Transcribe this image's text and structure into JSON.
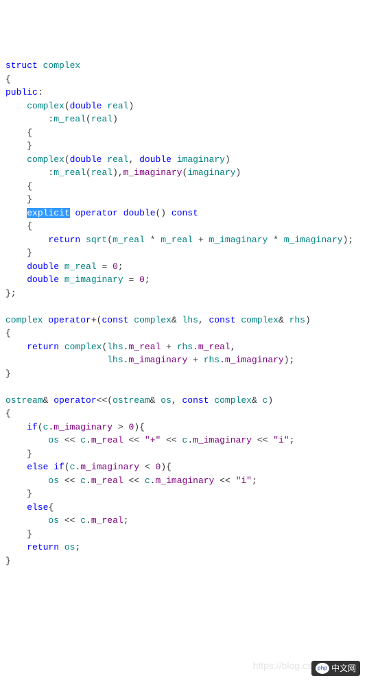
{
  "code": {
    "l1": {
      "struct": "struct",
      "complex": "complex"
    },
    "l3": {
      "public": "public"
    },
    "l4": {
      "complex": "complex",
      "double": "double",
      "real": "real"
    },
    "l5": {
      "m_real": "m_real",
      "real": "real"
    },
    "l8": {
      "complex": "complex",
      "double1": "double",
      "real": "real",
      "double2": "double",
      "imaginary": "imaginary"
    },
    "l9": {
      "m_real": "m_real",
      "real": "real",
      "m_imaginary": "m_imaginary",
      "imaginary": "imaginary"
    },
    "l12": {
      "explicit": "explicit",
      "operator": "operator",
      "double": "double",
      "const": "const"
    },
    "l14": {
      "return": "return",
      "sqrt": "sqrt",
      "m_real1": "m_real",
      "m_real2": "m_real",
      "m_imaginary1": "m_imaginary",
      "m_imaginary2": "m_imaginary"
    },
    "l16": {
      "double": "double",
      "m_real": "m_real",
      "zero": "0"
    },
    "l17": {
      "double": "double",
      "m_imaginary": "m_imaginary",
      "zero": "0"
    },
    "l20": {
      "complex1": "complex",
      "operator": "operator",
      "plus": "+",
      "const1": "const",
      "complex2": "complex",
      "lhs": "lhs",
      "const2": "const",
      "complex3": "complex",
      "rhs": "rhs"
    },
    "l22": {
      "return": "return",
      "complex": "complex",
      "lhs1": "lhs",
      "m_real1": "m_real",
      "rhs1": "rhs",
      "m_real2": "m_real"
    },
    "l23": {
      "lhs": "lhs",
      "m_imaginary1": "m_imaginary",
      "rhs": "rhs",
      "m_imaginary2": "m_imaginary"
    },
    "l26": {
      "ostream1": "ostream",
      "operator": "operator",
      "ltlt": "<<",
      "ostream2": "ostream",
      "os": "os",
      "const": "const",
      "complex": "complex",
      "c": "c"
    },
    "l28": {
      "if": "if",
      "c": "c",
      "m_imaginary": "m_imaginary",
      "zero": "0"
    },
    "l29": {
      "os": "os",
      "c1": "c",
      "m_real": "m_real",
      "plus": "\"+\"",
      "c2": "c",
      "m_imaginary": "m_imaginary",
      "i": "\"i\""
    },
    "l31": {
      "else": "else",
      "if": "if",
      "c": "c",
      "m_imaginary": "m_imaginary",
      "zero": "0"
    },
    "l32": {
      "os": "os",
      "c1": "c",
      "m_real": "m_real",
      "c2": "c",
      "m_imaginary": "m_imaginary",
      "i": "\"i\""
    },
    "l34": {
      "else": "else"
    },
    "l35": {
      "os": "os",
      "c": "c",
      "m_real": "m_real"
    },
    "l37": {
      "return": "return",
      "os": "os"
    }
  },
  "watermark": "https://blog.csdn.net/craft",
  "logo_text": "中文网",
  "logo_php": "php"
}
